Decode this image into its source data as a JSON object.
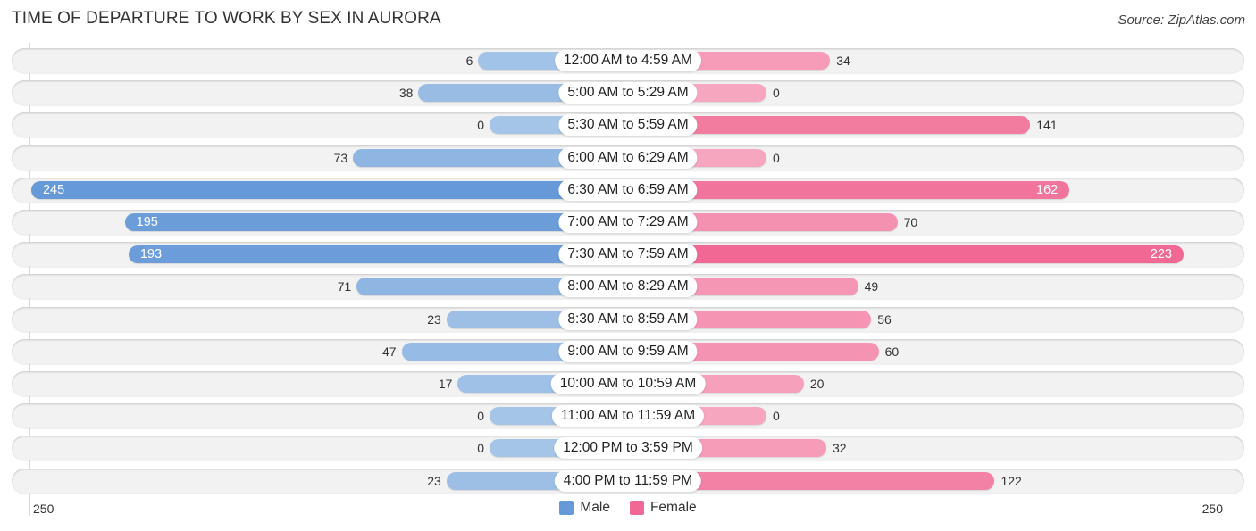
{
  "header": {
    "title": "TIME OF DEPARTURE TO WORK BY SEX IN AURORA",
    "source": "Source: ZipAtlas.com"
  },
  "colors": {
    "male_strong": "#6699d8",
    "male_light": "#a4c4e8",
    "female_strong": "#f06893",
    "female_light": "#f7a6bf"
  },
  "chart_data": {
    "type": "bar",
    "orientation": "horizontal-diverging",
    "title": "TIME OF DEPARTURE TO WORK BY SEX IN AURORA",
    "xlabel": "",
    "ylabel": "",
    "xlim": [
      -250,
      250
    ],
    "axis_ticks": {
      "left": "250",
      "right": "250"
    },
    "legend": {
      "position": "bottom-center",
      "entries": [
        "Male",
        "Female"
      ]
    },
    "grid": false,
    "categories": [
      "12:00 AM to 4:59 AM",
      "5:00 AM to 5:29 AM",
      "5:30 AM to 5:59 AM",
      "6:00 AM to 6:29 AM",
      "6:30 AM to 6:59 AM",
      "7:00 AM to 7:29 AM",
      "7:30 AM to 7:59 AM",
      "8:00 AM to 8:29 AM",
      "8:30 AM to 8:59 AM",
      "9:00 AM to 9:59 AM",
      "10:00 AM to 10:59 AM",
      "11:00 AM to 11:59 AM",
      "12:00 PM to 3:59 PM",
      "4:00 PM to 11:59 PM"
    ],
    "series": [
      {
        "name": "Male",
        "values": [
          6,
          38,
          0,
          73,
          245,
          195,
          193,
          71,
          23,
          47,
          17,
          0,
          0,
          23
        ]
      },
      {
        "name": "Female",
        "values": [
          34,
          0,
          141,
          0,
          162,
          70,
          223,
          49,
          56,
          60,
          20,
          0,
          32,
          122
        ]
      }
    ]
  }
}
